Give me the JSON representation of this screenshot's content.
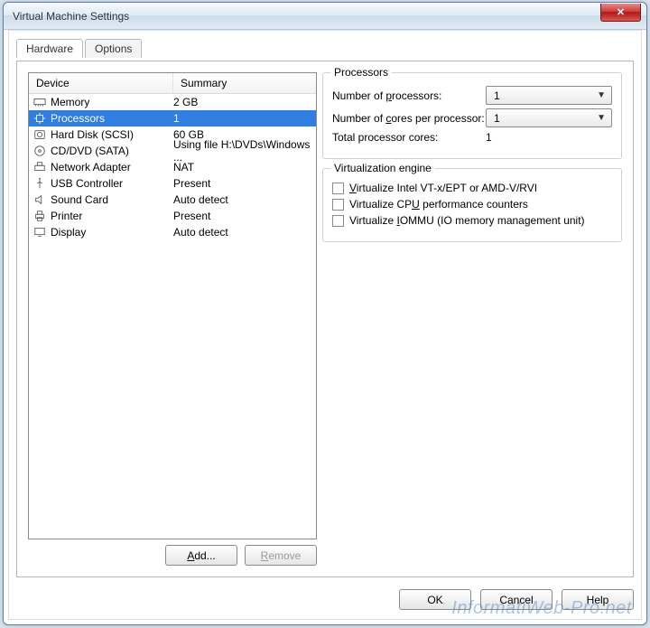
{
  "window": {
    "title": "Virtual Machine Settings"
  },
  "tabs": {
    "hardware": "Hardware",
    "options": "Options"
  },
  "list": {
    "header_device": "Device",
    "header_summary": "Summary",
    "rows": [
      {
        "name": "Memory",
        "summary": "2 GB"
      },
      {
        "name": "Processors",
        "summary": "1"
      },
      {
        "name": "Hard Disk (SCSI)",
        "summary": "60 GB"
      },
      {
        "name": "CD/DVD (SATA)",
        "summary": "Using file H:\\DVDs\\Windows ..."
      },
      {
        "name": "Network Adapter",
        "summary": "NAT"
      },
      {
        "name": "USB Controller",
        "summary": "Present"
      },
      {
        "name": "Sound Card",
        "summary": "Auto detect"
      },
      {
        "name": "Printer",
        "summary": "Present"
      },
      {
        "name": "Display",
        "summary": "Auto detect"
      }
    ],
    "add": "Add...",
    "remove": "Remove"
  },
  "processors": {
    "legend": "Processors",
    "num_proc_label": "Number of processors:",
    "num_proc_value": "1",
    "cores_label": "Number of cores per processor:",
    "cores_value": "1",
    "total_label": "Total processor cores:",
    "total_value": "1"
  },
  "virt": {
    "legend": "Virtualization engine",
    "vtx": "Virtualize Intel VT-x/EPT or AMD-V/RVI",
    "perf": "Virtualize CPU performance counters",
    "iommu": "Virtualize IOMMU (IO memory management unit)"
  },
  "footer": {
    "ok": "OK",
    "cancel": "Cancel",
    "help": "Help"
  },
  "watermark": "InformatiWeb-Pro.net"
}
